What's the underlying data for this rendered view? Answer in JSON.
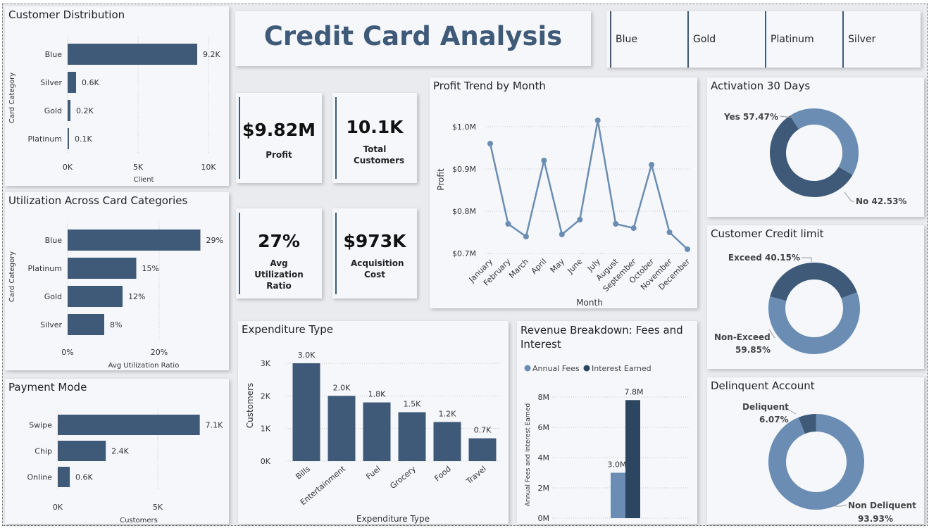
{
  "title": "Credit Card Analysis",
  "slicer": {
    "items": [
      "Blue",
      "Gold",
      "Platinum",
      "Silver"
    ]
  },
  "kpis": {
    "profit": {
      "value": "$9.82M",
      "label": "Profit"
    },
    "customers": {
      "value": "10.1K",
      "label": "Total Customers"
    },
    "utilization": {
      "value": "27%",
      "label": "Avg Utilization Ratio"
    },
    "acquisition": {
      "value": "$973K",
      "label": "Acquisition Cost"
    }
  },
  "colors": {
    "bar": "#3e5a78",
    "light": "#6b8db3",
    "dark": "#2c4560",
    "line": "#6b8db3"
  },
  "chart_data": [
    {
      "id": "customer_distribution",
      "type": "bar",
      "orientation": "horizontal",
      "title": "Customer Distribution",
      "ylabel": "Card Category",
      "xlabel": "Client",
      "categories": [
        "Blue",
        "Silver",
        "Gold",
        "Platinum"
      ],
      "values": [
        9200,
        600,
        200,
        100
      ],
      "data_labels": [
        "9.2K",
        "0.6K",
        "0.2K",
        "0.1K"
      ],
      "xlim": [
        0,
        10000
      ],
      "xticks": [
        "0K",
        "5K",
        "10K"
      ],
      "grid": true
    },
    {
      "id": "utilization_across",
      "type": "bar",
      "orientation": "horizontal",
      "title": "Utilization Across Card Categories",
      "ylabel": "Card Category",
      "xlabel": "Avg Utilization Ratio",
      "categories": [
        "Blue",
        "Platinum",
        "Gold",
        "Silver"
      ],
      "values": [
        29,
        15,
        12,
        8
      ],
      "data_labels": [
        "29%",
        "15%",
        "12%",
        "8%"
      ],
      "xlim": [
        0,
        30
      ],
      "xticks": [
        "0%",
        "20%"
      ],
      "grid": true
    },
    {
      "id": "payment_mode",
      "type": "bar",
      "orientation": "horizontal",
      "title": "Payment Mode",
      "xlabel": "Customers",
      "categories": [
        "Swipe",
        "Chip",
        "Online"
      ],
      "values": [
        7100,
        2400,
        600
      ],
      "data_labels": [
        "7.1K",
        "2.4K",
        "0.6K"
      ],
      "xlim": [
        0,
        7500
      ],
      "xticks": [
        "0K",
        "5K"
      ],
      "grid": true
    },
    {
      "id": "profit_trend",
      "type": "line",
      "title": "Profit Trend by Month",
      "xlabel": "Month",
      "ylabel": "Profit",
      "categories": [
        "January",
        "February",
        "March",
        "April",
        "May",
        "June",
        "July",
        "August",
        "September",
        "October",
        "November",
        "December"
      ],
      "values": [
        0.96,
        0.77,
        0.74,
        0.92,
        0.745,
        0.78,
        1.015,
        0.77,
        0.76,
        0.91,
        0.75,
        0.71
      ],
      "ylim": [
        0.7,
        1.0
      ],
      "yticks": [
        "$0.7M",
        "$0.8M",
        "$0.9M",
        "$1.0M"
      ],
      "grid": true
    },
    {
      "id": "expenditure_type",
      "type": "bar",
      "title": "Expenditure Type",
      "xlabel": "Expenditure Type",
      "ylabel": "Customers",
      "categories": [
        "Bills",
        "Entertainment",
        "Fuel",
        "Grocery",
        "Food",
        "Travel"
      ],
      "values": [
        3000,
        2000,
        1800,
        1500,
        1200,
        700
      ],
      "data_labels": [
        "3.0K",
        "2.0K",
        "1.8K",
        "1.5K",
        "1.2K",
        "0.7K"
      ],
      "ylim": [
        0,
        3000
      ],
      "yticks": [
        "0K",
        "1K",
        "2K",
        "3K"
      ],
      "grid": true
    },
    {
      "id": "revenue_breakdown",
      "type": "bar",
      "title": "Revenue Breakdown: Fees and Interest",
      "ylabel": "Annual Fees and Interest Earned",
      "series": [
        {
          "name": "Annual Fees",
          "values": [
            3.0
          ],
          "label": "3.0M"
        },
        {
          "name": "Interest Earned",
          "values": [
            7.8
          ],
          "label": "7.8M"
        }
      ],
      "ylim": [
        0,
        8
      ],
      "yticks": [
        "0M",
        "2M",
        "4M",
        "6M",
        "8M"
      ],
      "legend": "top-left"
    },
    {
      "id": "activation_30_days",
      "type": "pie",
      "donut": true,
      "title": "Activation 30 Days",
      "labels": [
        "Yes",
        "No"
      ],
      "values": [
        57.47,
        42.53
      ],
      "data_labels": [
        "Yes 57.47%",
        "No 42.53%"
      ]
    },
    {
      "id": "customer_credit_limit",
      "type": "pie",
      "donut": true,
      "title": "Customer Credit limit",
      "labels": [
        "Exceed",
        "Non-Exceed"
      ],
      "values": [
        40.15,
        59.85
      ],
      "data_labels": [
        "Exceed 40.15%",
        "Non-Exceed",
        "59.85%"
      ]
    },
    {
      "id": "delinquent_account",
      "type": "pie",
      "donut": true,
      "title": "Delinquent Account",
      "labels": [
        "Deliquent",
        "Non Deliquent"
      ],
      "values": [
        6.07,
        93.93
      ],
      "data_labels": [
        "Deliquent",
        "6.07%",
        "Non Deliquent",
        "93.93%"
      ]
    }
  ]
}
